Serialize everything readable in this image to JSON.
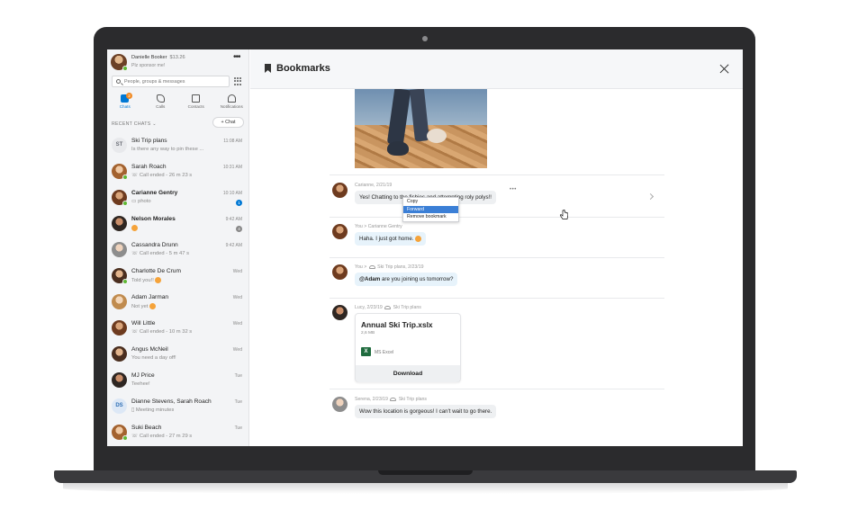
{
  "profile": {
    "name": "Danielle Booker",
    "credit": "$13.26",
    "mood": "Plz sponsor me!"
  },
  "search": {
    "placeholder": "People, groups & messages"
  },
  "nav": {
    "tabs": [
      {
        "label": "Chats",
        "badge": "2",
        "icon": "chats-icon"
      },
      {
        "label": "Calls",
        "icon": "calls-icon"
      },
      {
        "label": "Contacts",
        "icon": "contacts-icon"
      },
      {
        "label": "Notifications",
        "icon": "bell-icon"
      }
    ]
  },
  "recent": {
    "header": "RECENT CHATS",
    "new_chat": "+ Chat"
  },
  "chats": [
    {
      "name": "Ski Trip plans",
      "preview": "Is there any way to pin these ...",
      "time": "11:08 AM",
      "initials": "ST"
    },
    {
      "name": "Sarah Roach",
      "preview": "Call ended - 26 m 23 s",
      "time": "10:31 AM"
    },
    {
      "name": "Carianne Gentry",
      "preview": "photo",
      "time": "10:10 AM",
      "unread": "1"
    },
    {
      "name": "Nelson Morales",
      "preview": "",
      "time": "9:42 AM",
      "unread": "4"
    },
    {
      "name": "Cassandra Drunn",
      "preview": "Call ended - 5 m 47 s",
      "time": "9:42 AM"
    },
    {
      "name": "Charlotte De Crum",
      "preview": "Told you!!",
      "time": "Wed"
    },
    {
      "name": "Adam Jarman",
      "preview": "Not yet",
      "time": "Wed"
    },
    {
      "name": "Will Little",
      "preview": "Call ended - 10 m 32 s",
      "time": "Wed"
    },
    {
      "name": "Angus McNeil",
      "preview": "You need a day off!",
      "time": "Wed"
    },
    {
      "name": "MJ Price",
      "preview": "Teehee!",
      "time": "Tue"
    },
    {
      "name": "Dianne Stevens, Sarah Roach",
      "preview": "Meeting minutes",
      "time": "Tue",
      "initials": "DS"
    },
    {
      "name": "Suki Beach",
      "preview": "Call ended - 27 m 29 s",
      "time": "Tue"
    }
  ],
  "main": {
    "title": "Bookmarks",
    "messages": [
      {
        "meta": "Carianne, 2/21/19",
        "text": "Yes! Chatting to the fishies and attempting roly polys!!"
      },
      {
        "meta_from": "You",
        "meta_to": "Carianne Gentry",
        "text": "Haha. I just got home."
      },
      {
        "meta_from": "You",
        "meta_to": "Ski Trip plans, 2/23/19",
        "mention": "@Adam",
        "text": " are you joining us tomorrow?"
      },
      {
        "meta": "Lucy, 2/23/19",
        "meta_group": "Ski Trip plans"
      },
      {
        "meta": "Serena, 2/23/19",
        "meta_group": "Ski Trip plans",
        "text": "Wow this location is gorgeous! I can't wait to go there."
      }
    ],
    "file": {
      "name": "Annual Ski Trip.xslx",
      "size": "2,6 MB",
      "type": "MS Excel",
      "download": "Download"
    },
    "context_menu": [
      "Copy",
      "Forward",
      "Remove bookmark"
    ]
  }
}
